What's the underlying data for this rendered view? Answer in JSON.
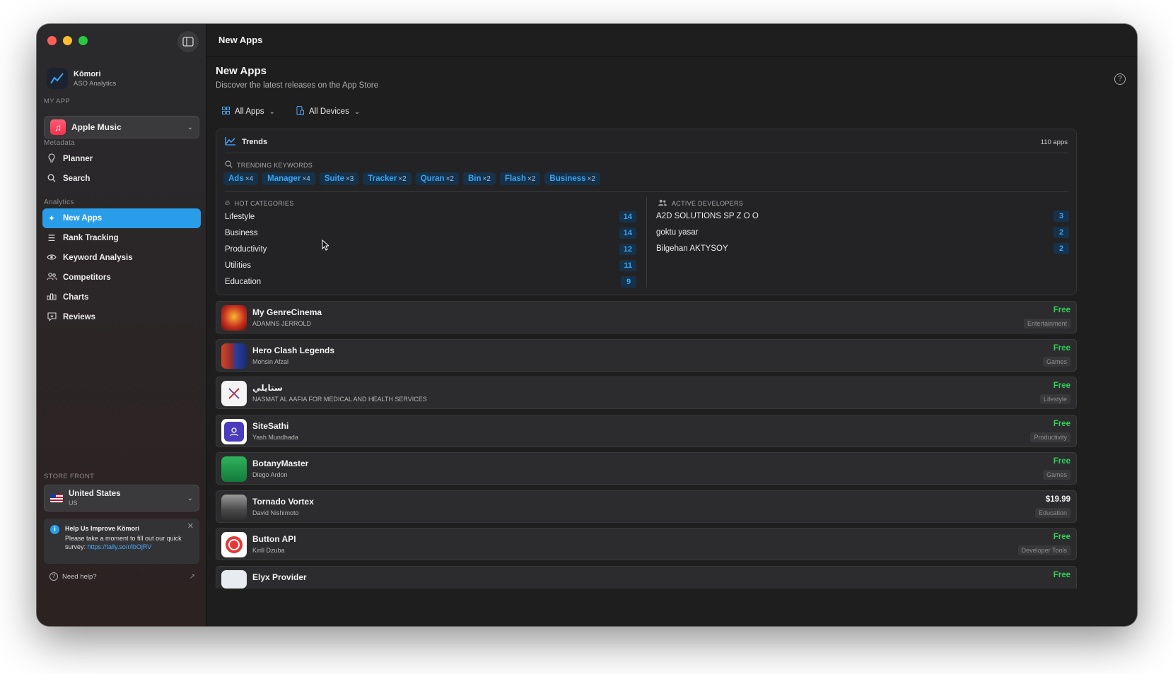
{
  "window": {
    "title": "New Apps"
  },
  "brand": {
    "name": "Kōmori",
    "subtitle": "ASO Analytics"
  },
  "sidebar": {
    "my_app_label": "MY APP",
    "selected_app": "Apple Music",
    "metadata_label": "Metadata",
    "metadata_items": [
      {
        "label": "Planner",
        "icon": "lightbulb-icon"
      },
      {
        "label": "Search",
        "icon": "search-icon"
      }
    ],
    "analytics_label": "Analytics",
    "analytics_items": [
      {
        "label": "New Apps",
        "icon": "sparkle-icon",
        "active": true
      },
      {
        "label": "Rank Tracking",
        "icon": "list-icon"
      },
      {
        "label": "Keyword Analysis",
        "icon": "eye-icon"
      },
      {
        "label": "Competitors",
        "icon": "people-icon"
      },
      {
        "label": "Charts",
        "icon": "bar-chart-icon"
      },
      {
        "label": "Reviews",
        "icon": "chat-icon"
      }
    ],
    "store_front_label": "STORE FRONT",
    "store": {
      "name": "United States",
      "code": "US"
    },
    "survey": {
      "title": "Help Us Improve Kōmori",
      "body": "Please take a moment to fill out our quick survey:",
      "link": "https://tally.so/r/lbOjRV"
    },
    "help": "Need help?"
  },
  "header": {
    "title": "New Apps",
    "subtitle": "Discover the latest releases on the App Store"
  },
  "filters": {
    "apps": "All Apps",
    "devices": "All Devices"
  },
  "trends": {
    "title": "Trends",
    "count": "110 apps",
    "keywords_label": "TRENDING KEYWORDS",
    "keywords": [
      {
        "word": "Ads",
        "mult": "×4"
      },
      {
        "word": "Manager",
        "mult": "×4"
      },
      {
        "word": "Suite",
        "mult": "×3"
      },
      {
        "word": "Tracker",
        "mult": "×2"
      },
      {
        "word": "Quran",
        "mult": "×2"
      },
      {
        "word": "Bin",
        "mult": "×2"
      },
      {
        "word": "Flash",
        "mult": "×2"
      },
      {
        "word": "Business",
        "mult": "×2"
      }
    ],
    "categories_label": "HOT CATEGORIES",
    "categories": [
      {
        "name": "Lifestyle",
        "count": "14"
      },
      {
        "name": "Business",
        "count": "14"
      },
      {
        "name": "Productivity",
        "count": "12"
      },
      {
        "name": "Utilities",
        "count": "11"
      },
      {
        "name": "Education",
        "count": "9"
      }
    ],
    "developers_label": "ACTIVE DEVELOPERS",
    "developers": [
      {
        "name": "A2D SOLUTIONS SP Z O O",
        "count": "3"
      },
      {
        "name": "goktu yasar",
        "count": "2"
      },
      {
        "name": "Bilgehan AKTYSOY",
        "count": "2"
      }
    ]
  },
  "apps": [
    {
      "name": "My GenreCinema",
      "developer": "ADAMNS JERROLD",
      "price": "Free",
      "category": "Entertainment",
      "icon_color": "#b8261c"
    },
    {
      "name": "Hero Clash Legends",
      "developer": "Mohsin Afzal",
      "price": "Free",
      "category": "Games",
      "icon_color": "#2b3a7a"
    },
    {
      "name": "ستايلي",
      "developer": "NASMAT AL AAFIA FOR MEDICAL AND HEALTH SERVICES",
      "price": "Free",
      "category": "Lifestyle",
      "icon_color": "#f4f4f4"
    },
    {
      "name": "SiteSathi",
      "developer": "Yash Mundhada",
      "price": "Free",
      "category": "Productivity",
      "icon_color": "#4b3bbd"
    },
    {
      "name": "BotanyMaster",
      "developer": "Diego Ardon",
      "price": "Free",
      "category": "Games",
      "icon_color": "#1f8a4a"
    },
    {
      "name": "Tornado Vortex",
      "developer": "David Nishimoto",
      "price": "$19.99",
      "category": "Education",
      "icon_color": "#6b6b6b"
    },
    {
      "name": "Button API",
      "developer": "Kirill Dzuba",
      "price": "Free",
      "category": "Developer Tools",
      "icon_color": "#ffffff"
    },
    {
      "name": "Elyx Provider",
      "developer": "",
      "price": "Free",
      "category": "",
      "icon_color": "#e8ecf0"
    }
  ]
}
